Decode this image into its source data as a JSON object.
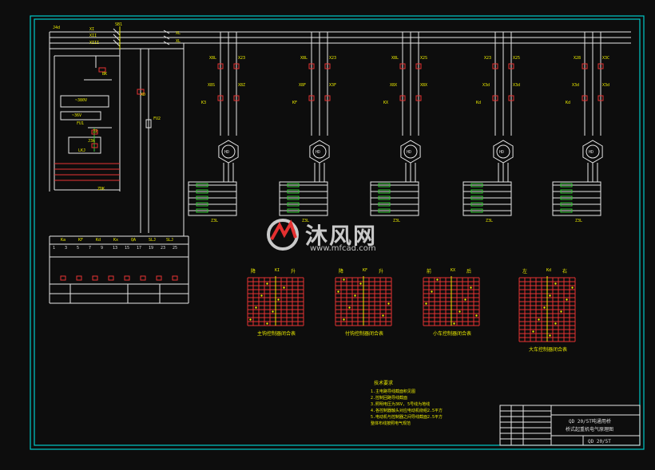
{
  "bus_labels": [
    "J4d",
    "XI",
    "XII",
    "XIII",
    "XL",
    "XL"
  ],
  "main_labels": {
    "qs": "SB1",
    "tr": "SBK",
    "ac380": "~380V",
    "ac36": "~36V",
    "fu1": "FU1",
    "fu2": "FU2",
    "lkj": "LKJ",
    "j2": "J2",
    "jk": "J3k",
    "k1": "XD",
    "k2": "ZDK",
    "bk": "BK"
  },
  "motor_label": "HD",
  "motor_groups": [
    {
      "id": "m1",
      "top": [
        "X8L",
        "X23"
      ],
      "mid": [
        "X8S",
        "X8Z"
      ],
      "coil": "K3"
    },
    {
      "id": "m2",
      "top": [
        "X8L",
        "X23"
      ],
      "mid": [
        "X8F",
        "X3F"
      ],
      "coil": "KF"
    },
    {
      "id": "m3",
      "top": [
        "X8L",
        "X2S"
      ],
      "mid": [
        "X8X",
        "X8X"
      ],
      "coil": "KX"
    },
    {
      "id": "m4",
      "top": [
        "X23",
        "X25"
      ],
      "mid": [
        "X3d",
        "X3d"
      ],
      "coil": "Kd"
    },
    {
      "id": "m5",
      "top": [
        "X28",
        "X3C"
      ],
      "mid": [
        "X3d",
        "X3d"
      ],
      "coil": "Kd"
    }
  ],
  "res_labels": [
    "Z3L",
    "Z3L",
    "Z3L",
    "Z3L",
    "Z3L"
  ],
  "ctrl_row": [
    "Ka",
    "KF",
    "Kd",
    "Kx",
    "QA",
    "SLJ",
    "SLJ"
  ],
  "ctrl_nums": [
    "1",
    "3",
    "5",
    "7",
    "9",
    "13",
    "15",
    "17",
    "19",
    "23",
    "25"
  ],
  "tables": [
    {
      "heading": [
        "降",
        "KI",
        "升"
      ],
      "caption": "主钩控制器闭合表"
    },
    {
      "heading": [
        "降",
        "KF",
        "升"
      ],
      "caption": "付钩控制器闭合表"
    },
    {
      "heading": [
        "前",
        "KX",
        "后"
      ],
      "caption": "小车控制器闭合表"
    },
    {
      "heading": [
        "左",
        "Kd",
        "右"
      ],
      "caption": "大车控制器闭合表"
    }
  ],
  "notes": {
    "title": "技术要求",
    "lines": [
      "1.主电路导线截面积见图",
      "2.控制回路导线截面",
      "3.照明电压为36V, 5号线为地线",
      "4.各控制器触头对应电动机绕组2.5平方",
      "5.电动机与控制器之间导线截面2.5平方",
      "  整体布线按照电气规范"
    ]
  },
  "title_block": {
    "line1": "QD 20/5T吨通用桥",
    "line2": "桥式起重机电气原理图",
    "code": "QD 20/5T"
  },
  "watermark": {
    "text": "沐风网",
    "url": "www.mfcad.com"
  }
}
